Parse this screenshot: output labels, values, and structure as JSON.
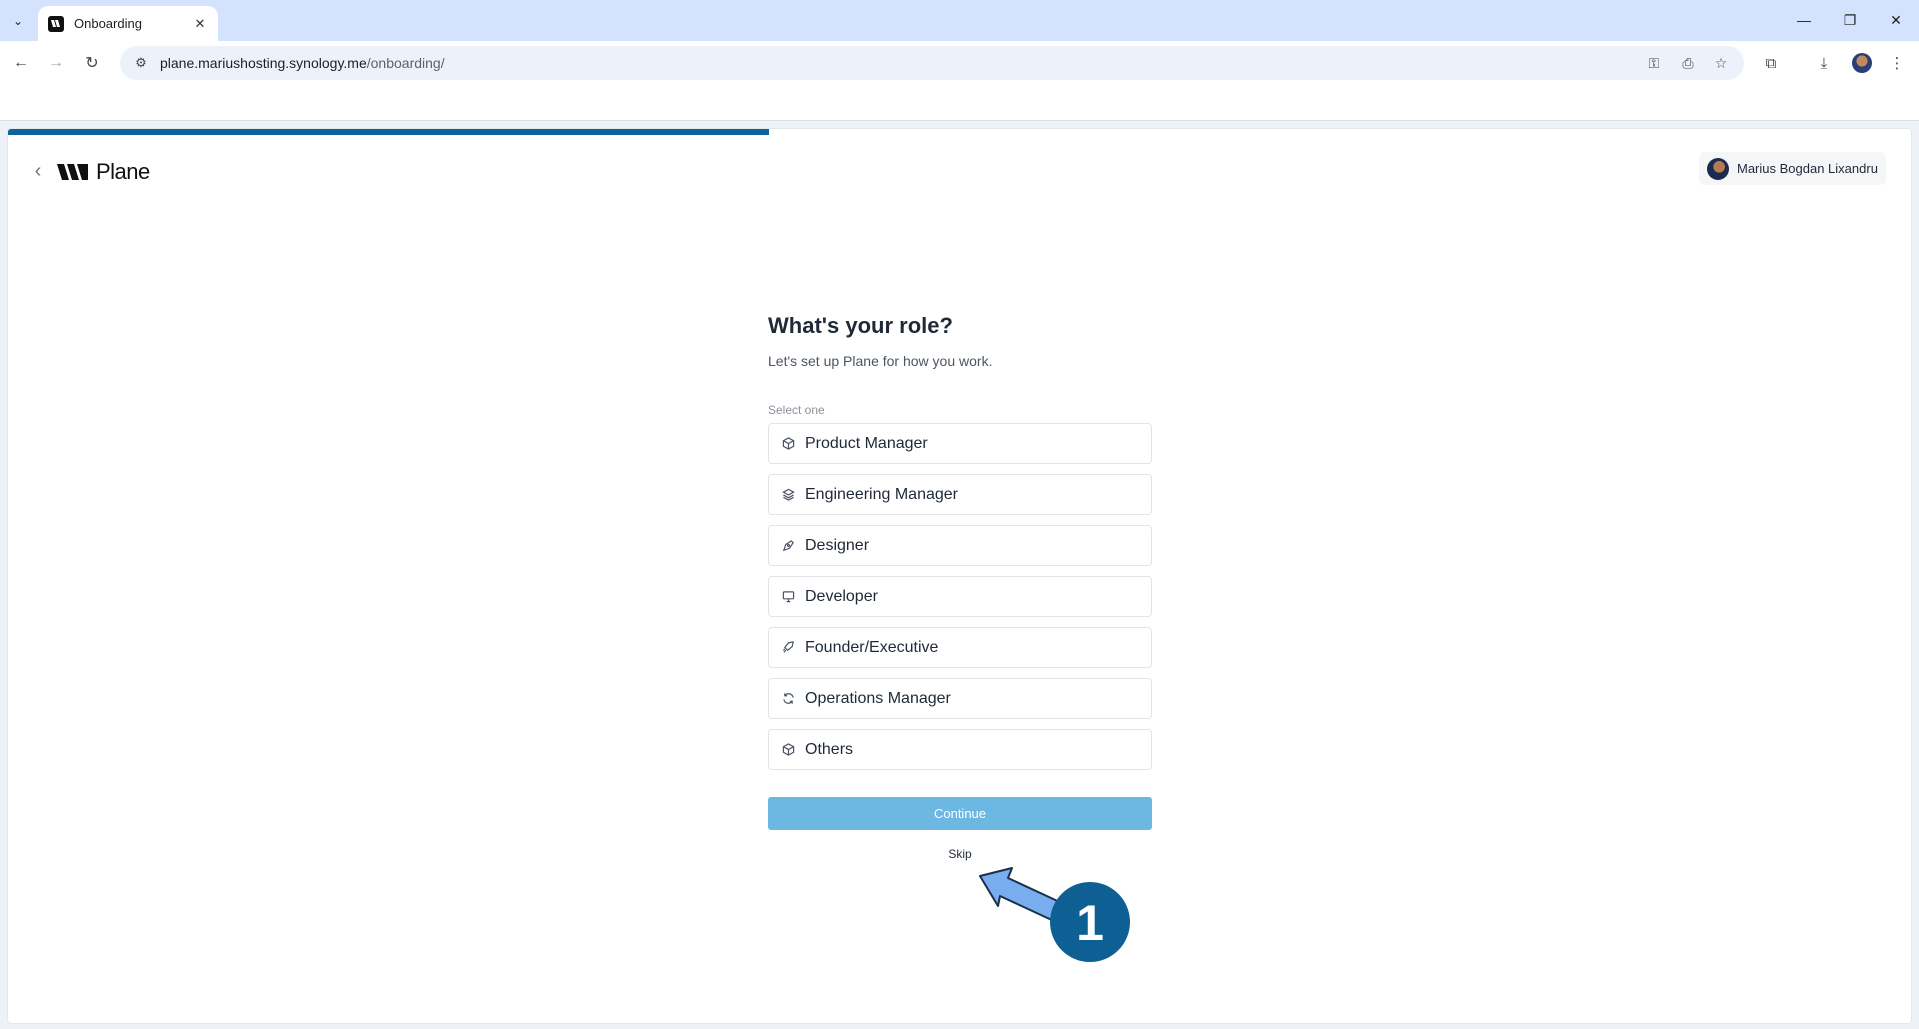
{
  "browser": {
    "tab_title": "Onboarding",
    "url_host": "plane.mariushosting.synology.me",
    "url_path": "/onboarding/"
  },
  "app": {
    "logo_text": "Plane",
    "user_name": "Marius Bogdan Lixandru",
    "progress": 0.4
  },
  "onboarding": {
    "heading": "What's your role?",
    "subheading": "Let's set up Plane for how you work.",
    "select_label": "Select one",
    "roles": [
      {
        "label": "Product Manager",
        "icon": "cube-icon"
      },
      {
        "label": "Engineering Manager",
        "icon": "layers-icon"
      },
      {
        "label": "Designer",
        "icon": "pen-tool-icon"
      },
      {
        "label": "Developer",
        "icon": "monitor-icon"
      },
      {
        "label": "Founder/Executive",
        "icon": "rocket-icon"
      },
      {
        "label": "Operations Manager",
        "icon": "refresh-icon"
      },
      {
        "label": "Others",
        "icon": "box-icon"
      }
    ],
    "continue_label": "Continue",
    "skip_label": "Skip"
  },
  "annotation": {
    "number": "1",
    "color": "#0e5f94",
    "arrow_color": "#78aef0"
  }
}
